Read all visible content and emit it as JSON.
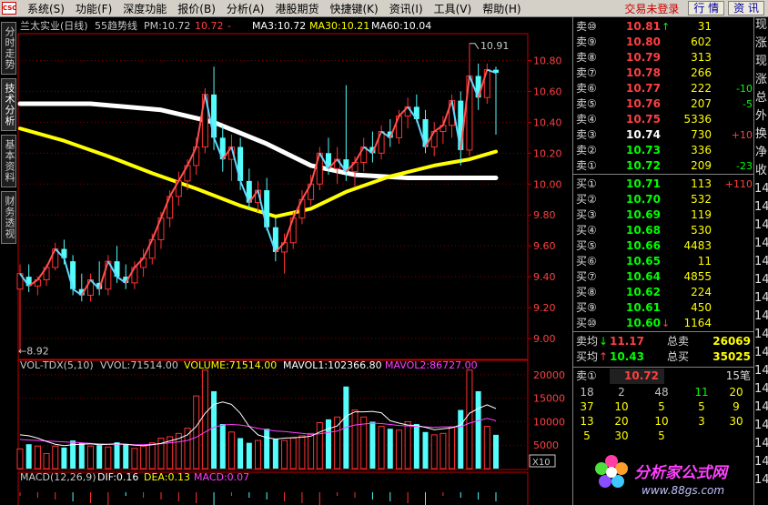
{
  "menu": {
    "logo": "CSC",
    "items": [
      "系统(S)",
      "功能(F)",
      "深度功能",
      "报价(B)",
      "分析(A)",
      "港股期货",
      "快捷键(K)",
      "资讯(I)",
      "工具(V)",
      "帮助(H)"
    ],
    "trade_status": "交易未登录",
    "btn_quote": "行 情",
    "btn_info": "资 讯"
  },
  "left_tabs": [
    "分时走势",
    "技术分析",
    "基本资料",
    "财务透视"
  ],
  "header": {
    "stock": "兰太实业(日线)",
    "indicator": "55趋势线",
    "pm_label": "PM:10.72",
    "price_val": "10.72",
    "price_extra": "-",
    "ma3": "MA3:10.72",
    "ma30": "MA30:10.21",
    "ma60": "MA60:10.04"
  },
  "vol_header": {
    "name": "VOL-TDX(5,10)",
    "vvol": "VVOL:71514.00",
    "volume": "VOLUME:71514.00",
    "mavol1": "MAVOL1:102366.80",
    "mavol2": "MAVOL2:86727.00"
  },
  "macd_header": {
    "name": "MACD(12,26,9)",
    "dif": "DIF:0.16",
    "dea": "DEA:0.13",
    "macd": "MACD:0.07"
  },
  "chart_data": {
    "type": "candlestick",
    "price_axis": {
      "ticks": [
        "10.80",
        "10.60",
        "10.40",
        "10.20",
        "10.00",
        "9.80",
        "9.60",
        "9.40",
        "9.20",
        "9.00"
      ],
      "range": [
        8.9,
        10.95
      ]
    },
    "high_marker": "10.91",
    "low_marker": "←8.92",
    "volume_axis": {
      "ticks": [
        "20000",
        "15000",
        "10000",
        "5000"
      ],
      "unit": "X10"
    },
    "candles": [
      {
        "o": 9.32,
        "h": 9.48,
        "l": 8.92,
        "c": 9.42
      },
      {
        "o": 9.4,
        "h": 9.48,
        "l": 9.3,
        "c": 9.34
      },
      {
        "o": 9.34,
        "h": 9.4,
        "l": 9.28,
        "c": 9.38
      },
      {
        "o": 9.38,
        "h": 9.48,
        "l": 9.34,
        "c": 9.46
      },
      {
        "o": 9.46,
        "h": 9.62,
        "l": 9.44,
        "c": 9.58
      },
      {
        "o": 9.58,
        "h": 9.64,
        "l": 9.48,
        "c": 9.52
      },
      {
        "o": 9.5,
        "h": 9.54,
        "l": 9.28,
        "c": 9.32
      },
      {
        "o": 9.32,
        "h": 9.42,
        "l": 9.24,
        "c": 9.28
      },
      {
        "o": 9.28,
        "h": 9.42,
        "l": 9.24,
        "c": 9.38
      },
      {
        "o": 9.36,
        "h": 9.5,
        "l": 9.28,
        "c": 9.32
      },
      {
        "o": 9.32,
        "h": 9.54,
        "l": 9.28,
        "c": 9.5
      },
      {
        "o": 9.5,
        "h": 9.6,
        "l": 9.36,
        "c": 9.4
      },
      {
        "o": 9.4,
        "h": 9.48,
        "l": 9.32,
        "c": 9.36
      },
      {
        "o": 9.36,
        "h": 9.5,
        "l": 9.32,
        "c": 9.46
      },
      {
        "o": 9.46,
        "h": 9.58,
        "l": 9.4,
        "c": 9.52
      },
      {
        "o": 9.52,
        "h": 9.68,
        "l": 9.48,
        "c": 9.64
      },
      {
        "o": 9.64,
        "h": 9.82,
        "l": 9.58,
        "c": 9.78
      },
      {
        "o": 9.78,
        "h": 9.96,
        "l": 9.72,
        "c": 9.92
      },
      {
        "o": 9.92,
        "h": 10.08,
        "l": 9.86,
        "c": 10.02
      },
      {
        "o": 10.02,
        "h": 10.16,
        "l": 9.96,
        "c": 10.12
      },
      {
        "o": 10.12,
        "h": 10.3,
        "l": 10.06,
        "c": 10.24
      },
      {
        "o": 10.24,
        "h": 10.62,
        "l": 10.2,
        "c": 10.58
      },
      {
        "o": 10.58,
        "h": 10.76,
        "l": 10.22,
        "c": 10.3
      },
      {
        "o": 10.3,
        "h": 10.38,
        "l": 10.08,
        "c": 10.16
      },
      {
        "o": 10.16,
        "h": 10.32,
        "l": 10.02,
        "c": 10.24
      },
      {
        "o": 10.24,
        "h": 10.3,
        "l": 9.96,
        "c": 10.02
      },
      {
        "o": 10.02,
        "h": 10.1,
        "l": 9.84,
        "c": 9.88
      },
      {
        "o": 9.88,
        "h": 10.02,
        "l": 9.82,
        "c": 9.96
      },
      {
        "o": 9.96,
        "h": 10.04,
        "l": 9.7,
        "c": 9.72
      },
      {
        "o": 9.72,
        "h": 9.78,
        "l": 9.5,
        "c": 9.56
      },
      {
        "o": 9.56,
        "h": 9.68,
        "l": 9.42,
        "c": 9.62
      },
      {
        "o": 9.62,
        "h": 9.82,
        "l": 9.58,
        "c": 9.78
      },
      {
        "o": 9.78,
        "h": 9.96,
        "l": 9.74,
        "c": 9.9
      },
      {
        "o": 9.9,
        "h": 10.06,
        "l": 9.86,
        "c": 10.0
      },
      {
        "o": 10.0,
        "h": 10.24,
        "l": 9.96,
        "c": 10.2
      },
      {
        "o": 10.2,
        "h": 10.3,
        "l": 10.06,
        "c": 10.1
      },
      {
        "o": 10.1,
        "h": 10.24,
        "l": 10.0,
        "c": 10.16
      },
      {
        "o": 10.16,
        "h": 10.64,
        "l": 10.02,
        "c": 10.08
      },
      {
        "o": 10.08,
        "h": 10.18,
        "l": 9.98,
        "c": 10.14
      },
      {
        "o": 10.14,
        "h": 10.3,
        "l": 10.08,
        "c": 10.24
      },
      {
        "o": 10.24,
        "h": 10.34,
        "l": 10.14,
        "c": 10.2
      },
      {
        "o": 10.2,
        "h": 10.38,
        "l": 10.16,
        "c": 10.34
      },
      {
        "o": 10.34,
        "h": 10.42,
        "l": 10.24,
        "c": 10.3
      },
      {
        "o": 10.3,
        "h": 10.48,
        "l": 10.26,
        "c": 10.44
      },
      {
        "o": 10.44,
        "h": 10.56,
        "l": 10.36,
        "c": 10.5
      },
      {
        "o": 10.5,
        "h": 10.58,
        "l": 10.4,
        "c": 10.42
      },
      {
        "o": 10.42,
        "h": 10.48,
        "l": 10.2,
        "c": 10.24
      },
      {
        "o": 10.24,
        "h": 10.4,
        "l": 10.18,
        "c": 10.34
      },
      {
        "o": 10.34,
        "h": 10.44,
        "l": 10.26,
        "c": 10.38
      },
      {
        "o": 10.38,
        "h": 10.58,
        "l": 10.3,
        "c": 10.54
      },
      {
        "o": 10.54,
        "h": 10.6,
        "l": 10.12,
        "c": 10.22
      },
      {
        "o": 10.22,
        "h": 10.91,
        "l": 10.18,
        "c": 10.7
      },
      {
        "o": 10.7,
        "h": 10.78,
        "l": 10.48,
        "c": 10.56
      },
      {
        "o": 10.56,
        "h": 10.78,
        "l": 10.52,
        "c": 10.74
      },
      {
        "o": 10.74,
        "h": 10.76,
        "l": 10.32,
        "c": 10.72
      }
    ],
    "ma30_line": [
      {
        "i": 0,
        "v": 10.36
      },
      {
        "i": 5,
        "v": 10.28
      },
      {
        "i": 10,
        "v": 10.18
      },
      {
        "i": 15,
        "v": 10.07
      },
      {
        "i": 20,
        "v": 9.97
      },
      {
        "i": 25,
        "v": 9.86
      },
      {
        "i": 29,
        "v": 9.79
      },
      {
        "i": 33,
        "v": 9.84
      },
      {
        "i": 37,
        "v": 9.95
      },
      {
        "i": 42,
        "v": 10.05
      },
      {
        "i": 47,
        "v": 10.12
      },
      {
        "i": 51,
        "v": 10.16
      },
      {
        "i": 54,
        "v": 10.21
      }
    ],
    "ma60_line": [
      {
        "i": 0,
        "v": 10.52
      },
      {
        "i": 8,
        "v": 10.52
      },
      {
        "i": 16,
        "v": 10.48
      },
      {
        "i": 22,
        "v": 10.4
      },
      {
        "i": 28,
        "v": 10.26
      },
      {
        "i": 33,
        "v": 10.12
      },
      {
        "i": 38,
        "v": 10.06
      },
      {
        "i": 44,
        "v": 10.04
      },
      {
        "i": 54,
        "v": 10.04
      }
    ],
    "volumes": [
      4200,
      5200,
      4800,
      3200,
      4800,
      4500,
      6000,
      5500,
      4800,
      5000,
      4600,
      5600,
      5200,
      4300,
      4800,
      5500,
      6500,
      6800,
      7500,
      8600,
      15500,
      21000,
      16500,
      9500,
      7800,
      6500,
      5500,
      6000,
      8500,
      6400,
      6000,
      6500,
      7000,
      7500,
      9800,
      10500,
      11000,
      17500,
      12500,
      11000,
      10000,
      9000,
      8500,
      8200,
      10000,
      9500,
      7800,
      7200,
      7500,
      8800,
      12500,
      21000,
      16500,
      9000,
      7200
    ],
    "mavol1": [
      7200,
      7000,
      6500,
      5800,
      5200,
      4900,
      5100,
      5200,
      5300,
      5100,
      5200,
      5300,
      5200,
      5000,
      4900,
      5100,
      5400,
      5900,
      6400,
      7200,
      9000,
      11800,
      13700,
      14200,
      13700,
      11800,
      9000,
      7200,
      6600,
      6300,
      6500,
      6600,
      6700,
      6900,
      7800,
      8500,
      9100,
      11200,
      12100,
      12100,
      12200,
      11900,
      10200,
      9700,
      9300,
      9200,
      8800,
      8300,
      8500,
      8700,
      9300,
      11800,
      12800,
      13600,
      12800
    ],
    "mavol2": [
      6200,
      6100,
      6000,
      5900,
      5800,
      5700,
      5600,
      5500,
      5400,
      5300,
      5200,
      5200,
      5200,
      5100,
      5100,
      5200,
      5300,
      5500,
      5700,
      6000,
      6700,
      7800,
      8800,
      9300,
      9400,
      9300,
      9000,
      8600,
      8300,
      8000,
      7900,
      7700,
      7500,
      7300,
      7400,
      7700,
      8000,
      8800,
      9300,
      9500,
      9700,
      9600,
      9400,
      9200,
      9100,
      9000,
      8900,
      8800,
      8900,
      8900,
      8900,
      9700,
      10200,
      10700,
      10200
    ]
  },
  "quote": {
    "asks": [
      {
        "label": "卖⑩",
        "price": "10.81",
        "vol": "31",
        "chg": "",
        "chgColor": "#00ff00",
        "arrow": "↑"
      },
      {
        "label": "卖⑨",
        "price": "10.80",
        "vol": "602",
        "chg": "",
        "chgColor": "#00ff00",
        "arrow": ""
      },
      {
        "label": "卖⑧",
        "price": "10.79",
        "vol": "313",
        "chg": "",
        "chgColor": "#00ff00",
        "arrow": ""
      },
      {
        "label": "卖⑦",
        "price": "10.78",
        "vol": "266",
        "chg": "",
        "chgColor": "#00ff00",
        "arrow": ""
      },
      {
        "label": "卖⑥",
        "price": "10.77",
        "vol": "222",
        "chg": "-10",
        "chgColor": "#00ff00",
        "arrow": ""
      },
      {
        "label": "卖⑤",
        "price": "10.76",
        "vol": "207",
        "chg": "-5",
        "chgColor": "#00ff00",
        "arrow": ""
      },
      {
        "label": "卖④",
        "price": "10.75",
        "vol": "5336",
        "chg": "",
        "chgColor": "#00ff00",
        "arrow": ""
      },
      {
        "label": "卖③",
        "price": "10.74",
        "vol": "730",
        "chg": "+10",
        "chgColor": "#ff4040",
        "arrow": ""
      },
      {
        "label": "卖②",
        "price": "10.73",
        "vol": "336",
        "chg": "",
        "chgColor": "#00ff00",
        "arrow": ""
      },
      {
        "label": "卖①",
        "price": "10.72",
        "vol": "209",
        "chg": "-23",
        "chgColor": "#00ff00",
        "arrow": ""
      }
    ],
    "bids": [
      {
        "label": "买①",
        "price": "10.71",
        "vol": "113",
        "chg": "+110",
        "chgColor": "#ff4040",
        "arrow": ""
      },
      {
        "label": "买②",
        "price": "10.70",
        "vol": "532",
        "chg": "",
        "chgColor": "#00ff00",
        "arrow": ""
      },
      {
        "label": "买③",
        "price": "10.69",
        "vol": "119",
        "chg": "",
        "chgColor": "#00ff00",
        "arrow": ""
      },
      {
        "label": "买④",
        "price": "10.68",
        "vol": "530",
        "chg": "",
        "chgColor": "#00ff00",
        "arrow": ""
      },
      {
        "label": "买⑤",
        "price": "10.66",
        "vol": "4483",
        "chg": "",
        "chgColor": "#00ff00",
        "arrow": ""
      },
      {
        "label": "买⑥",
        "price": "10.65",
        "vol": "11",
        "chg": "",
        "chgColor": "#00ff00",
        "arrow": ""
      },
      {
        "label": "买⑦",
        "price": "10.64",
        "vol": "4855",
        "chg": "",
        "chgColor": "#00ff00",
        "arrow": ""
      },
      {
        "label": "买⑧",
        "price": "10.62",
        "vol": "224",
        "chg": "",
        "chgColor": "#00ff00",
        "arrow": ""
      },
      {
        "label": "买⑨",
        "price": "10.61",
        "vol": "450",
        "chg": "",
        "chgColor": "#00ff00",
        "arrow": ""
      },
      {
        "label": "买⑩",
        "price": "10.60",
        "vol": "1164",
        "chg": "",
        "chgColor": "#ff4040",
        "arrow": "↓"
      }
    ],
    "avg_sell_label": "卖均",
    "avg_sell": "11.17",
    "total_sell_label": "总卖",
    "total_sell": "26069",
    "avg_buy_label": "买均",
    "avg_buy": "10.43",
    "total_buy_label": "总买",
    "total_buy": "35025",
    "sell1_label": "卖①",
    "sell1_price": "10.72",
    "sell1_count": "15笔",
    "orders": [
      [
        "18",
        "2",
        "48",
        "11",
        "20"
      ],
      [
        "37",
        "10",
        "5",
        "5",
        "9"
      ],
      [
        "13",
        "20",
        "10",
        "3",
        "30"
      ],
      [
        "5",
        "30",
        "5",
        "",
        ""
      ]
    ],
    "order_colors": [
      [
        "#c0c0c0",
        "#c0c0c0",
        "#c0c0c0",
        "#00ff00",
        "#ffff00"
      ],
      [
        "#ffff00",
        "#ffff00",
        "#ffff00",
        "#ffff00",
        "#ffff00"
      ],
      [
        "#ffff00",
        "#ffff00",
        "#ffff00",
        "#ffff00",
        "#ffff00"
      ],
      [
        "#ffff00",
        "#ffff00",
        "#ffff00",
        "#ffff00",
        "#ffff00"
      ]
    ]
  },
  "far_right": [
    "现",
    "涨",
    "现",
    "涨",
    "总",
    "外",
    "换",
    "净",
    "收",
    "14",
    "14",
    "14",
    "14",
    "14",
    "14",
    "14",
    "14",
    "14",
    "14",
    "14",
    "14",
    "14",
    "14",
    "14",
    "14",
    "14"
  ],
  "watermark": {
    "text1": "分析家公式网",
    "text2": "www.88gs.com"
  },
  "colors": {
    "up": "#ff3232",
    "down": "#54fcfc",
    "ma30": "#ffff00",
    "ma60": "#ffffff",
    "grid": "#800000",
    "axis": "#c00000"
  }
}
